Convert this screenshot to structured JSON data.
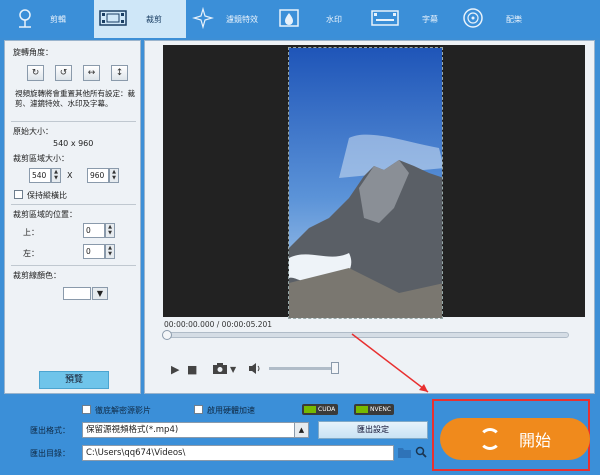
{
  "tabs": [
    {
      "label": "剪輯",
      "icon": "tree-icon",
      "active": false
    },
    {
      "label": "裁剪",
      "icon": "film-crop-icon",
      "active": true
    },
    {
      "label": "濾鏡特效",
      "icon": "sparkle-icon",
      "active": false
    },
    {
      "label": "水印",
      "icon": "watermark-icon",
      "active": false
    },
    {
      "label": "字幕",
      "icon": "subtitle-icon",
      "active": false
    },
    {
      "label": "配樂",
      "icon": "music-disc-icon",
      "active": false
    }
  ],
  "left": {
    "rotation_title": "旋轉角度：",
    "rotation_buttons": [
      {
        "icon": "rotate-right-icon",
        "glyph": "↻"
      },
      {
        "icon": "rotate-left-icon",
        "glyph": "↺"
      },
      {
        "icon": "flip-horizontal-icon",
        "glyph": "↔"
      },
      {
        "icon": "flip-vertical-icon",
        "glyph": "↕"
      }
    ],
    "rotation_note": "視頻旋轉將會重置其他所有設定：裁剪、濾鏡特效、水印及字幕。",
    "original_size_label": "原始大小：",
    "original_size_value": "540 x 960",
    "crop_size_label": "裁剪區域大小：",
    "crop_width": "540",
    "crop_x_sep": "X",
    "crop_height": "960",
    "keep_ratio_label": "保持縱橫比",
    "crop_pos_label": "裁剪區域的位置：",
    "top_label": "上：",
    "top_value": "0",
    "left_label": "左：",
    "left_value": "0",
    "line_color_label": "裁剪線顏色：",
    "preview_label": "預覽"
  },
  "player": {
    "time": "00:00:00.000 / 00:00:05.201",
    "progress": 0
  },
  "bottom": {
    "hw_check_label": "徹底解密源影片",
    "gpu_check_label": "啟用硬體加速",
    "chip_cuda": "CUDA",
    "chip_nvenc": "NVENC",
    "format_label": "匯出格式：",
    "format_value": "保留源視頻格式(*.mp4)",
    "export_settings": "匯出設定",
    "dir_label": "匯出目錄：",
    "dir_value": "C:\\Users\\qq674\\Videos\\",
    "start_label": "開始"
  },
  "colors": {
    "accent": "#3b8fd8",
    "start": "#f08a1c",
    "highlight": "#e83030"
  }
}
